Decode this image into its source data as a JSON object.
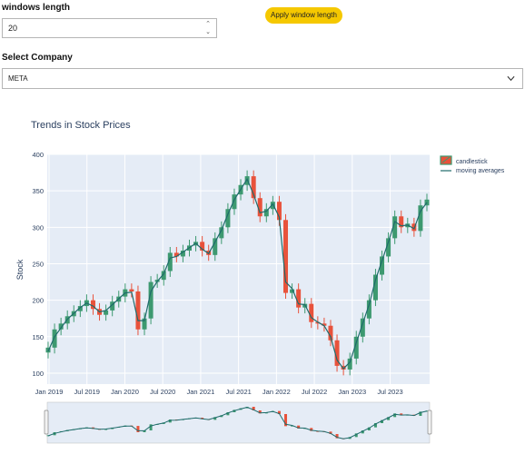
{
  "window_length": {
    "label": "windows length",
    "value": "20"
  },
  "apply_button": {
    "label": "Apply window length"
  },
  "company_select": {
    "label": "Select Company",
    "value": "META"
  },
  "colors": {
    "accent": "#f5c800",
    "plot_bg": "#e5ecf6",
    "increasing": "#3d9970",
    "decreasing": "#e8523b",
    "moving_average": "#1f6b6b",
    "title": "#2a3f5f"
  },
  "chart_data": {
    "type": "candlestick",
    "title": "Trends in Stock Prices",
    "xlabel": "",
    "ylabel": "Stock",
    "ylim": [
      85,
      400
    ],
    "yticks": [
      "100",
      "150",
      "200",
      "250",
      "300",
      "350",
      "400"
    ],
    "xticks": [
      "Jan 2019",
      "Jul 2019",
      "Jan 2020",
      "Jul 2020",
      "Jan 2021",
      "Jul 2021",
      "Jan 2022",
      "Jul 2022",
      "Jan 2023",
      "Jul 2023"
    ],
    "legend": {
      "position": "top-right",
      "entries": [
        "candlestick",
        "moving averages"
      ]
    },
    "grid": true,
    "range_slider": true,
    "x": [
      "2019-01",
      "2019-02",
      "2019-03",
      "2019-04",
      "2019-05",
      "2019-06",
      "2019-07",
      "2019-08",
      "2019-09",
      "2019-10",
      "2019-11",
      "2019-12",
      "2020-01",
      "2020-02",
      "2020-03",
      "2020-04",
      "2020-05",
      "2020-06",
      "2020-07",
      "2020-08",
      "2020-09",
      "2020-10",
      "2020-11",
      "2020-12",
      "2021-01",
      "2021-02",
      "2021-03",
      "2021-04",
      "2021-05",
      "2021-06",
      "2021-07",
      "2021-08",
      "2021-09",
      "2021-10",
      "2021-11",
      "2021-12",
      "2022-01",
      "2022-02",
      "2022-03",
      "2022-04",
      "2022-05",
      "2022-06",
      "2022-07",
      "2022-08",
      "2022-09",
      "2022-10",
      "2022-11",
      "2022-12",
      "2023-01",
      "2023-02",
      "2023-03",
      "2023-04",
      "2023-05",
      "2023-06",
      "2023-07",
      "2023-08",
      "2023-09",
      "2023-10",
      "2023-11",
      "2023-12"
    ],
    "series": [
      {
        "name": "candlestick",
        "close": [
          135,
          160,
          168,
          178,
          185,
          192,
          200,
          188,
          180,
          186,
          198,
          205,
          215,
          212,
          160,
          175,
          225,
          228,
          240,
          265,
          260,
          268,
          275,
          280,
          268,
          262,
          285,
          300,
          325,
          345,
          358,
          370,
          340,
          315,
          325,
          335,
          310,
          210,
          215,
          190,
          195,
          170,
          168,
          165,
          145,
          110,
          105,
          120,
          150,
          175,
          200,
          235,
          260,
          285,
          315,
          300,
          305,
          295,
          330,
          338
        ]
      },
      {
        "name": "moving averages",
        "close": [
          130,
          150,
          162,
          174,
          182,
          190,
          196,
          192,
          184,
          186,
          194,
          202,
          210,
          211,
          172,
          172,
          212,
          226,
          236,
          258,
          260,
          266,
          272,
          278,
          270,
          264,
          280,
          296,
          318,
          338,
          352,
          366,
          345,
          320,
          322,
          332,
          314,
          225,
          216,
          195,
          194,
          176,
          170,
          165,
          150,
          118,
          106,
          115,
          142,
          168,
          194,
          228,
          254,
          280,
          308,
          302,
          303,
          298,
          322,
          334
        ]
      }
    ]
  }
}
